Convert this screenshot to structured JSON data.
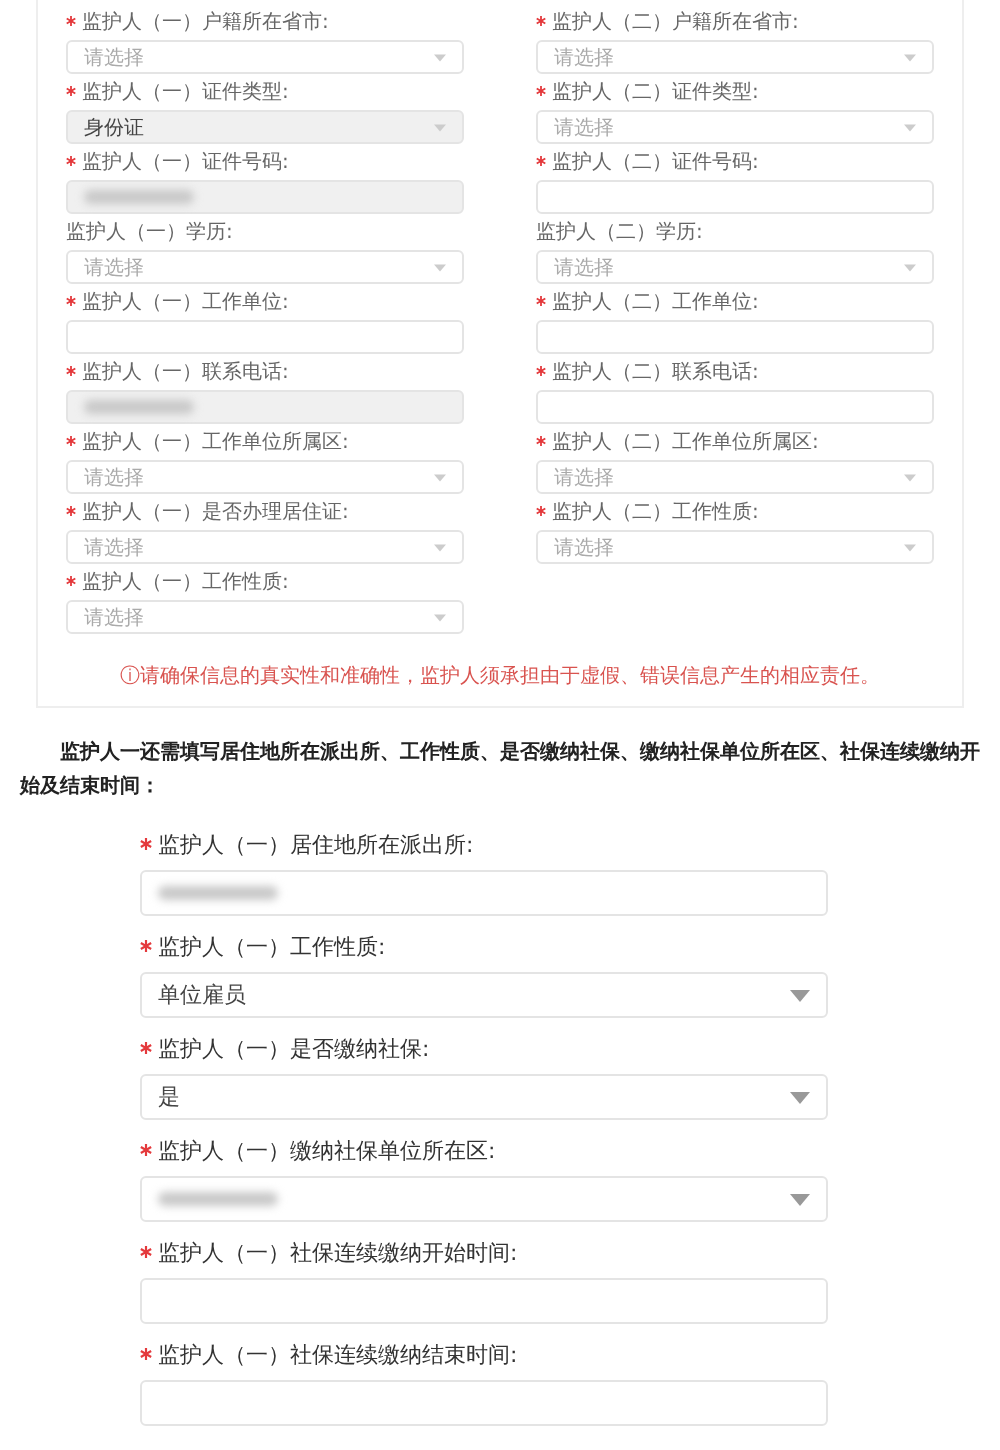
{
  "top_form": {
    "left": [
      {
        "label": "监护人（一）户籍所在省市:",
        "required": true,
        "kind": "select",
        "placeholder": "请选择",
        "disabled": false
      },
      {
        "label": "监护人（一）证件类型:",
        "required": true,
        "kind": "select",
        "value": "身份证",
        "disabled": true
      },
      {
        "label": "监护人（一）证件号码:",
        "required": true,
        "kind": "text",
        "disabled": true,
        "redacted": true
      },
      {
        "label": "监护人（一）学历:",
        "required": false,
        "kind": "select",
        "placeholder": "请选择",
        "disabled": false
      },
      {
        "label": "监护人（一）工作单位:",
        "required": true,
        "kind": "text",
        "disabled": false
      },
      {
        "label": "监护人（一）联系电话:",
        "required": true,
        "kind": "text",
        "disabled": true,
        "redacted": true
      },
      {
        "label": "监护人（一）工作单位所属区:",
        "required": true,
        "kind": "select",
        "placeholder": "请选择",
        "disabled": false
      },
      {
        "label": "监护人（一）是否办理居住证:",
        "required": true,
        "kind": "select",
        "placeholder": "请选择",
        "disabled": false
      },
      {
        "label": "监护人（一）工作性质:",
        "required": true,
        "kind": "select",
        "placeholder": "请选择",
        "disabled": false
      }
    ],
    "right": [
      {
        "label": "监护人（二）户籍所在省市:",
        "required": true,
        "kind": "select",
        "placeholder": "请选择",
        "disabled": false
      },
      {
        "label": "监护人（二）证件类型:",
        "required": true,
        "kind": "select",
        "placeholder": "请选择",
        "disabled": false
      },
      {
        "label": "监护人（二）证件号码:",
        "required": true,
        "kind": "text",
        "disabled": false
      },
      {
        "label": "监护人（二）学历:",
        "required": false,
        "kind": "select",
        "placeholder": "请选择",
        "disabled": false
      },
      {
        "label": "监护人（二）工作单位:",
        "required": true,
        "kind": "text",
        "disabled": false
      },
      {
        "label": "监护人（二）联系电话:",
        "required": true,
        "kind": "text",
        "disabled": false
      },
      {
        "label": "监护人（二）工作单位所属区:",
        "required": true,
        "kind": "select",
        "placeholder": "请选择",
        "disabled": false
      },
      {
        "label": "监护人（二）工作性质:",
        "required": true,
        "kind": "select",
        "placeholder": "请选择",
        "disabled": false
      }
    ],
    "notice": "ⓘ请确保信息的真实性和准确性，监护人须承担由于虚假、错误信息产生的相应责任。"
  },
  "paragraph": "监护人一还需填写居住地所在派出所、工作性质、是否缴纳社保、缴纳社保单位所在区、社保连续缴纳开始及结束时间：",
  "bottom_form": [
    {
      "label": "监护人（一）居住地所在派出所:",
      "required": true,
      "kind": "text",
      "disabled": false,
      "redacted": true
    },
    {
      "label": "监护人（一）工作性质:",
      "required": true,
      "kind": "select",
      "value": "单位雇员",
      "disabled": false
    },
    {
      "label": "监护人（一）是否缴纳社保:",
      "required": true,
      "kind": "select",
      "value": "是",
      "disabled": false
    },
    {
      "label": "监护人（一）缴纳社保单位所在区:",
      "required": true,
      "kind": "select",
      "disabled": false,
      "redacted": true
    },
    {
      "label": "监护人（一）社保连续缴纳开始时间:",
      "required": true,
      "kind": "text",
      "disabled": false
    },
    {
      "label": "监护人（一）社保连续缴纳结束时间:",
      "required": true,
      "kind": "text",
      "disabled": false
    }
  ]
}
